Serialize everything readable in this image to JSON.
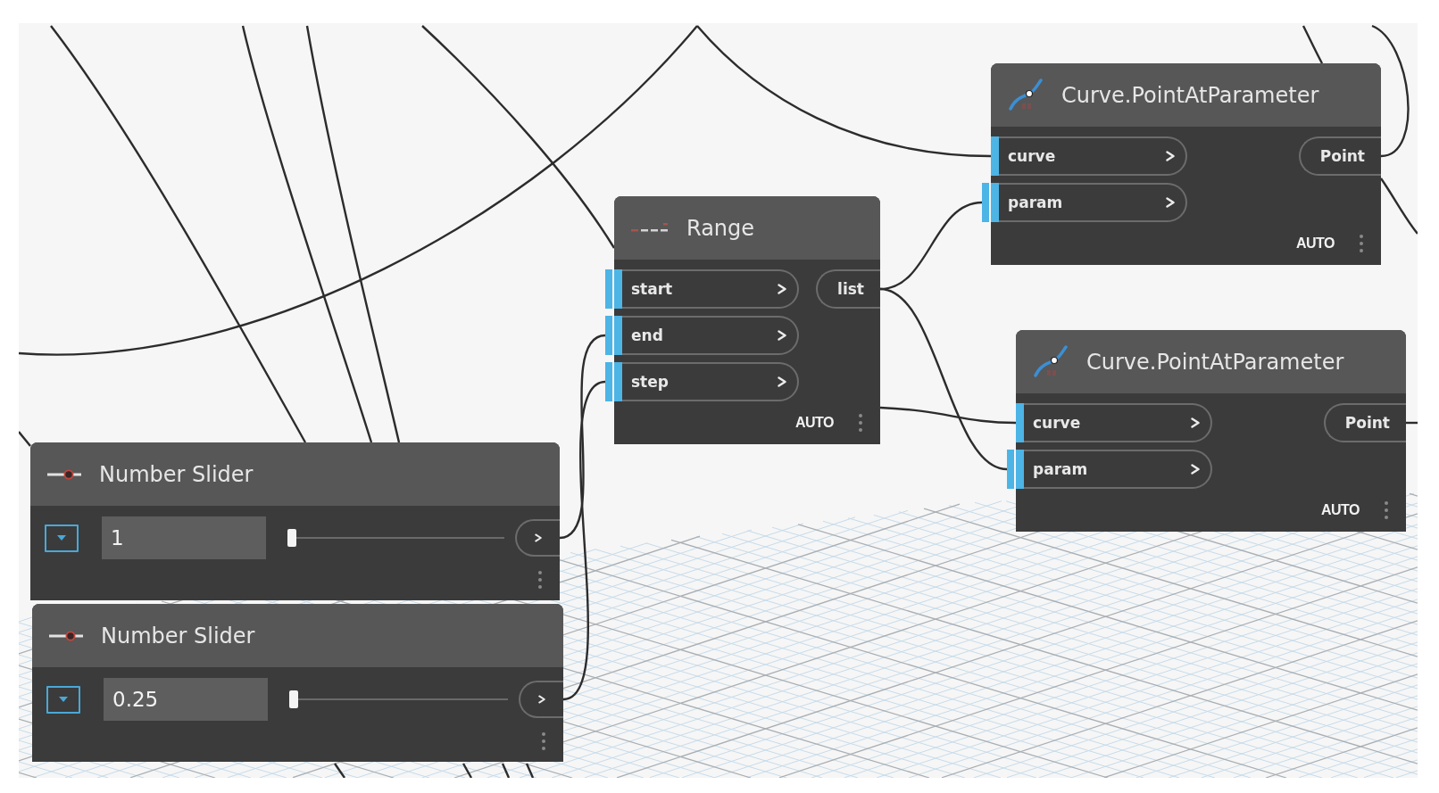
{
  "canvas": {
    "nodes": [
      {
        "kind": "curve",
        "title": "Curve.PointAtParameter",
        "inputs": [
          {
            "label": "curve",
            "double_bar": false
          },
          {
            "label": "param",
            "double_bar": true
          }
        ],
        "outputs": [
          {
            "label": "Point"
          }
        ],
        "lacing": "AUTO"
      },
      {
        "kind": "range",
        "title": "Range",
        "inputs": [
          {
            "label": "start",
            "double_bar": true
          },
          {
            "label": "end",
            "double_bar": true
          },
          {
            "label": "step",
            "double_bar": true
          }
        ],
        "outputs": [
          {
            "label": "list"
          }
        ],
        "lacing": "AUTO"
      },
      {
        "kind": "curve",
        "title": "Curve.PointAtParameter",
        "inputs": [
          {
            "label": "curve",
            "double_bar": false
          },
          {
            "label": "param",
            "double_bar": true
          }
        ],
        "outputs": [
          {
            "label": "Point"
          }
        ],
        "lacing": "AUTO"
      },
      {
        "kind": "slider",
        "title": "Number Slider",
        "value": "1",
        "level": 0
      },
      {
        "kind": "slider",
        "title": "Number Slider",
        "value": "0.25",
        "level": 0
      }
    ]
  }
}
